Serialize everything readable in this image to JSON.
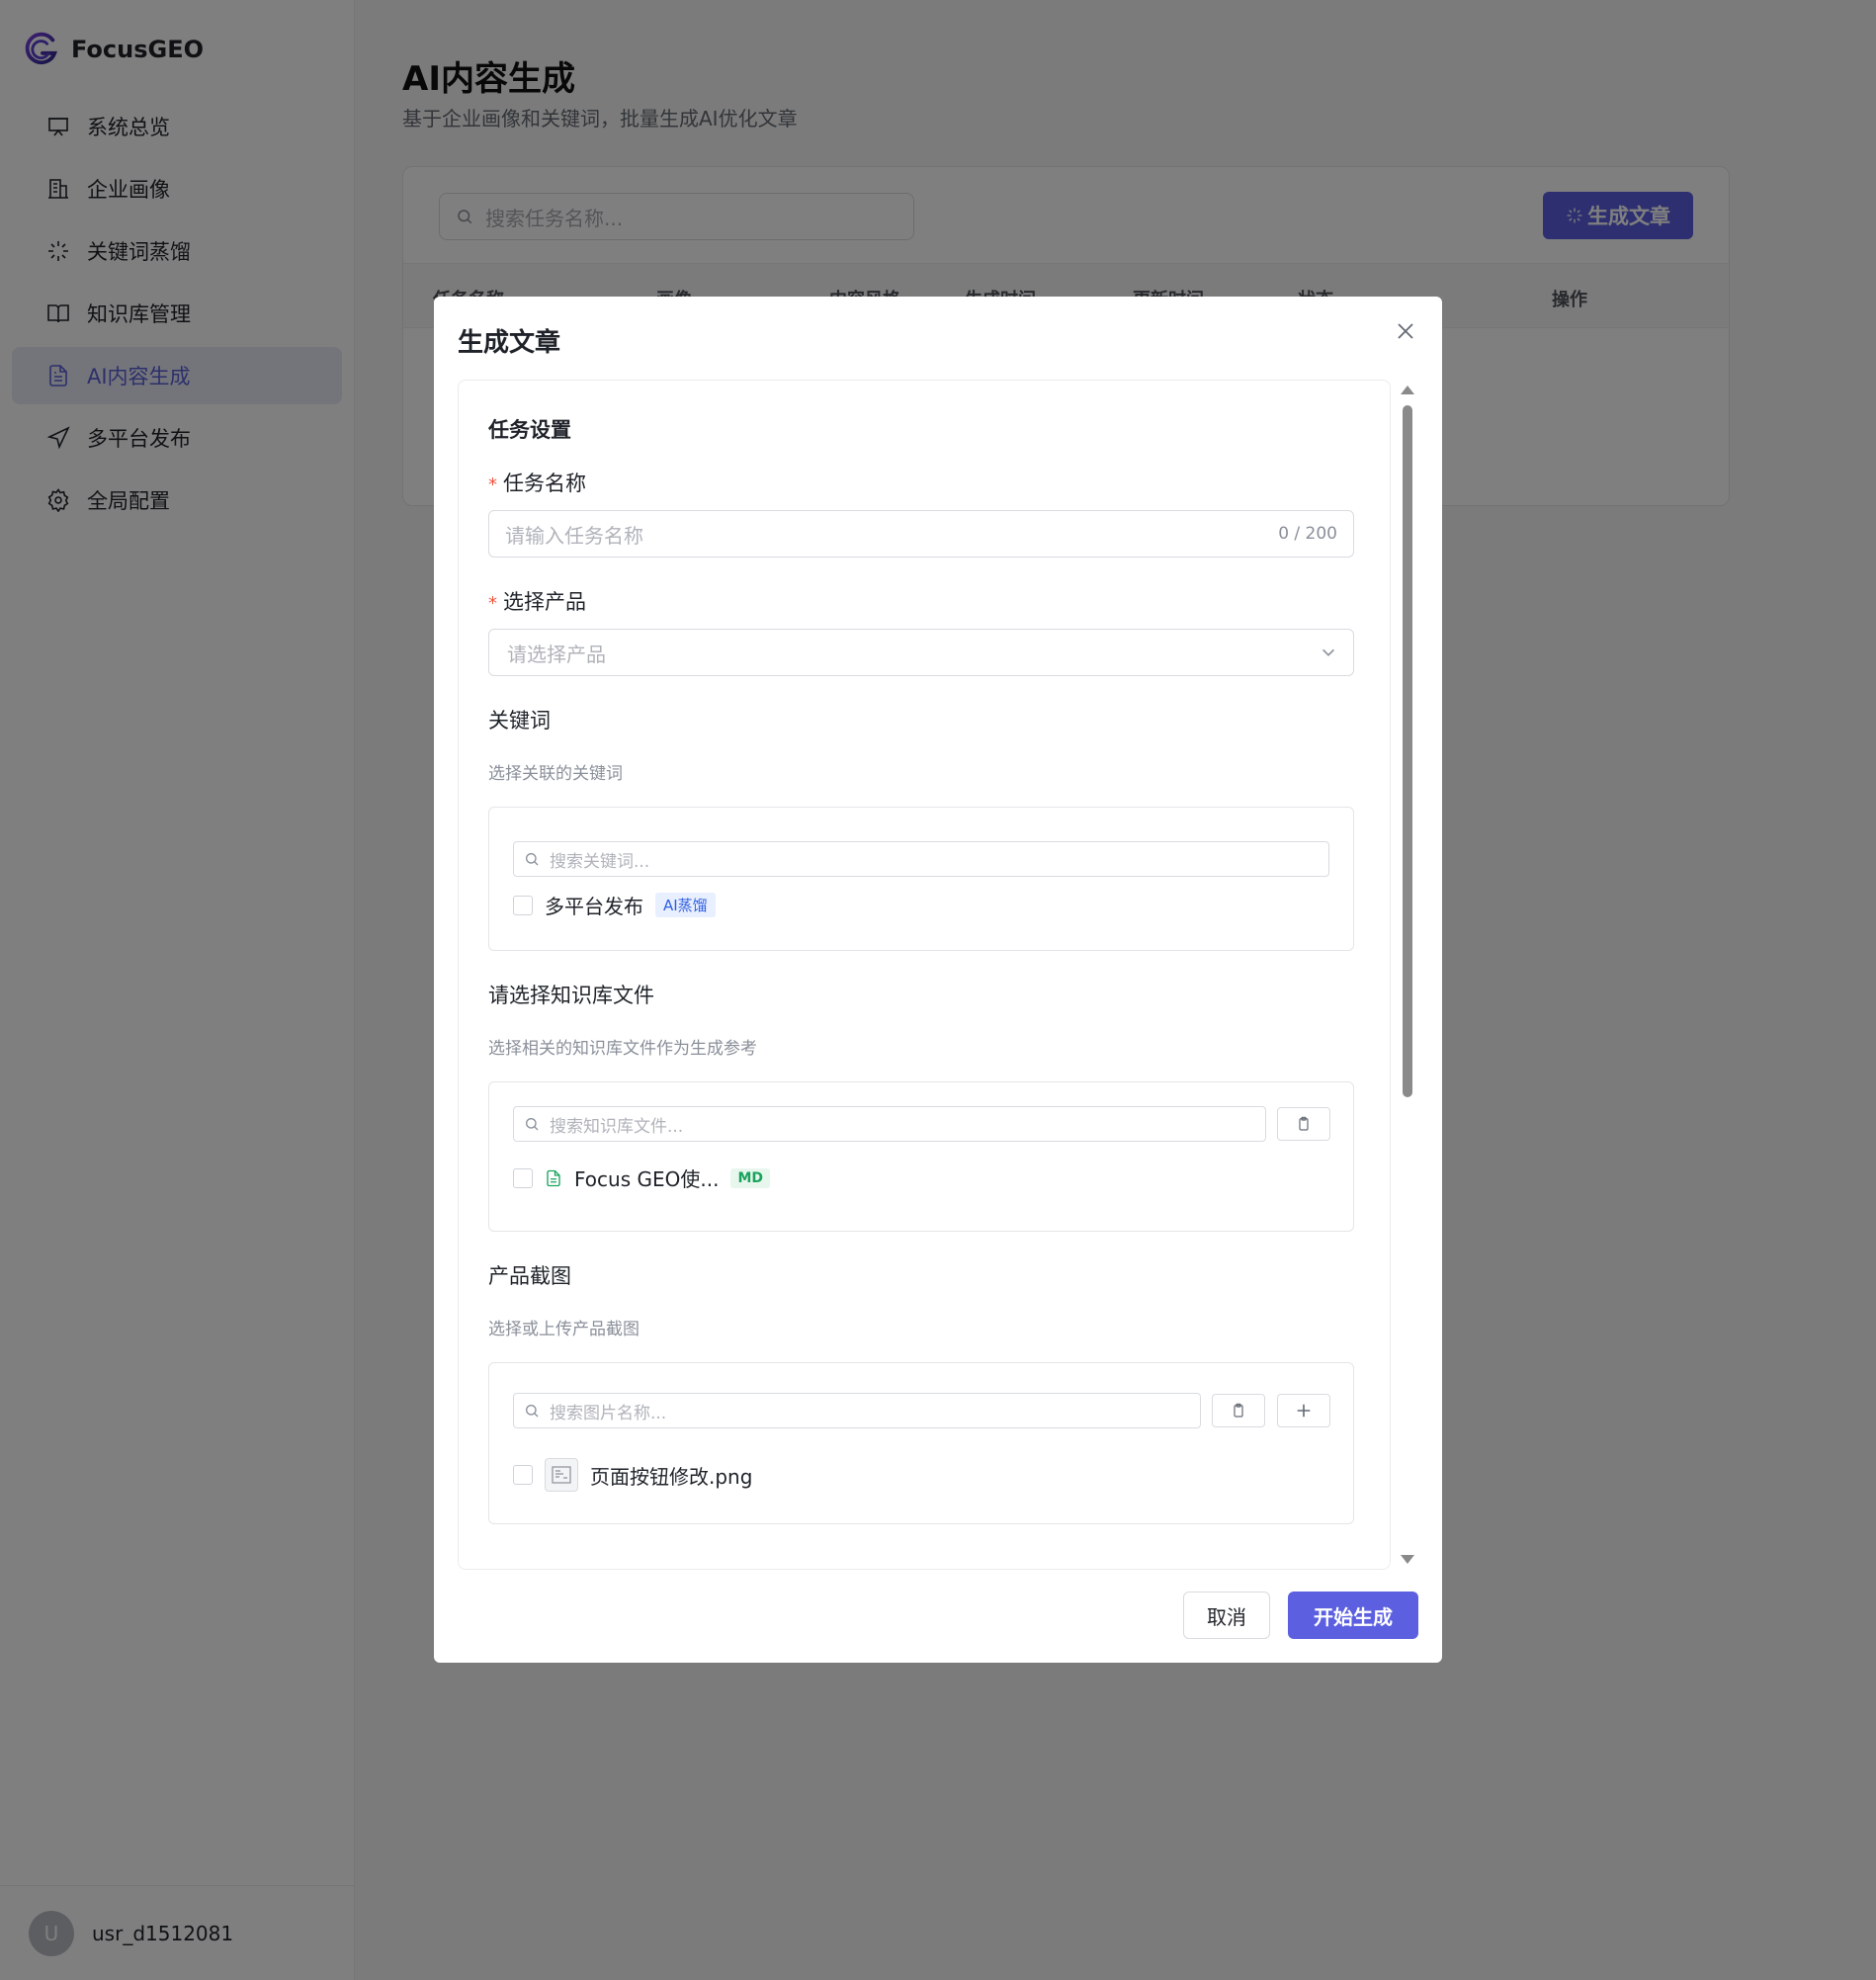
{
  "brand": {
    "name": "FocusGEO"
  },
  "sidebar": {
    "items": [
      {
        "label": "系统总览",
        "icon": "presentation-icon"
      },
      {
        "label": "企业画像",
        "icon": "building-icon"
      },
      {
        "label": "关键词蒸馏",
        "icon": "sparkle-icon"
      },
      {
        "label": "知识库管理",
        "icon": "book-icon"
      },
      {
        "label": "AI内容生成",
        "icon": "document-icon",
        "active": true
      },
      {
        "label": "多平台发布",
        "icon": "send-icon"
      },
      {
        "label": "全局配置",
        "icon": "gear-icon"
      }
    ],
    "user": {
      "avatar_letter": "U",
      "name": "usr_d1512081"
    }
  },
  "page": {
    "title": "AI内容生成",
    "subtitle": "基于企业画像和关键词，批量生成AI优化文章",
    "search_placeholder": "搜索任务名称...",
    "generate_button": "生成文章",
    "table_headers": [
      "任务名称",
      "画像",
      "内容风格",
      "生成时间",
      "更新时间",
      "状态",
      "操作"
    ]
  },
  "modal": {
    "title": "生成文章",
    "section_title": "任务设置",
    "task_name": {
      "label": "任务名称",
      "placeholder": "请输入任务名称",
      "count": "0 / 200"
    },
    "product": {
      "label": "选择产品",
      "placeholder": "请选择产品"
    },
    "keywords": {
      "label": "关键词",
      "hint": "选择关联的关键词",
      "search_placeholder": "搜索关键词...",
      "items": [
        {
          "label": "多平台发布",
          "tag": "AI蒸馏"
        }
      ]
    },
    "knowledge": {
      "label": "请选择知识库文件",
      "hint": "选择相关的知识库文件作为生成参考",
      "search_placeholder": "搜索知识库文件...",
      "items": [
        {
          "label": "Focus GEO使...",
          "tag": "MD"
        }
      ]
    },
    "screenshots": {
      "label": "产品截图",
      "hint": "选择或上传产品截图",
      "search_placeholder": "搜索图片名称...",
      "items": [
        {
          "label": "页面按钮修改.png"
        }
      ]
    },
    "cancel_button": "取消",
    "submit_button": "开始生成"
  },
  "colors": {
    "accent": "#5b5fe0",
    "active_bg": "#e9eaf7",
    "required": "#f5533d"
  }
}
